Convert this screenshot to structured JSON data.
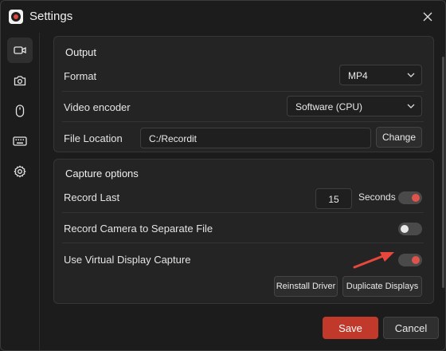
{
  "window": {
    "title": "Settings"
  },
  "sidebar": {
    "items": [
      {
        "icon": "video-camera-icon",
        "active": true
      },
      {
        "icon": "camera-icon",
        "active": false
      },
      {
        "icon": "mouse-icon",
        "active": false
      },
      {
        "icon": "keyboard-icon",
        "active": false
      },
      {
        "icon": "gear-icon",
        "active": false
      }
    ]
  },
  "output": {
    "title": "Output",
    "format_label": "Format",
    "format_value": "MP4",
    "encoder_label": "Video encoder",
    "encoder_value": "Software (CPU)",
    "location_label": "File Location",
    "location_value": "C:/Recordit",
    "change_label": "Change"
  },
  "capture": {
    "title": "Capture options",
    "record_last_label": "Record Last",
    "record_last_value": "15",
    "seconds_label": "Seconds",
    "record_last_on": true,
    "camera_label": "Record Camera to Separate File",
    "camera_on": false,
    "virtual_label": "Use Virtual Display Capture",
    "virtual_on": true,
    "reinstall_label": "Reinstall Driver",
    "duplicate_label": "Duplicate Displays"
  },
  "footer": {
    "save_label": "Save",
    "cancel_label": "Cancel"
  },
  "colors": {
    "accent": "#c0392b",
    "toggle_knob_on": "#e0534a",
    "annotation_arrow": "#e8473d"
  }
}
